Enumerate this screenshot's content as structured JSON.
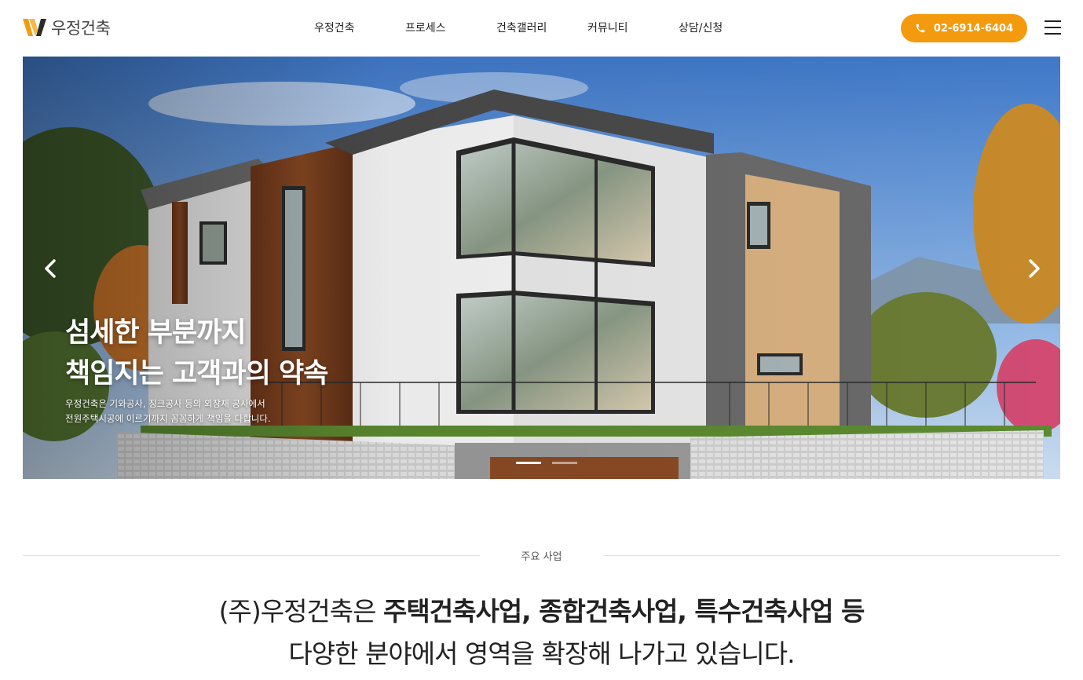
{
  "header": {
    "logo_text": "우정건축",
    "nav": [
      {
        "label": "우정건축"
      },
      {
        "label": "프로세스"
      },
      {
        "label": "건축갤러리"
      },
      {
        "label": "커뮤니티"
      },
      {
        "label": "상담/신청"
      }
    ],
    "phone_label": "02-6914-6404",
    "accent_color": "#f39a0e",
    "phone_icon": "phone-icon",
    "menu_icon": "hamburger-menu-icon"
  },
  "hero": {
    "headline_line1": "섬세한 부분까지",
    "headline_line2": "책임지는 고객과의 약속",
    "sub_line1": "우정건축은 기와공사, 징크공사 등의 외장재 공사에서",
    "sub_line2": "전원주택시공에 이르기까지 꼼꼼하게 책임을 다합니다.",
    "prev_icon": "chevron-left-icon",
    "next_icon": "chevron-right-icon",
    "slide_count": 2,
    "active_slide": 1
  },
  "section": {
    "label": "주요 사업",
    "intro_prefix": "(주)우정건축은 ",
    "intro_bold": "주택건축사업, 종합건축사업, 특수건축사업 등",
    "intro_line2": "다양한 분야에서 영역을 확장해 나가고 있습니다."
  }
}
